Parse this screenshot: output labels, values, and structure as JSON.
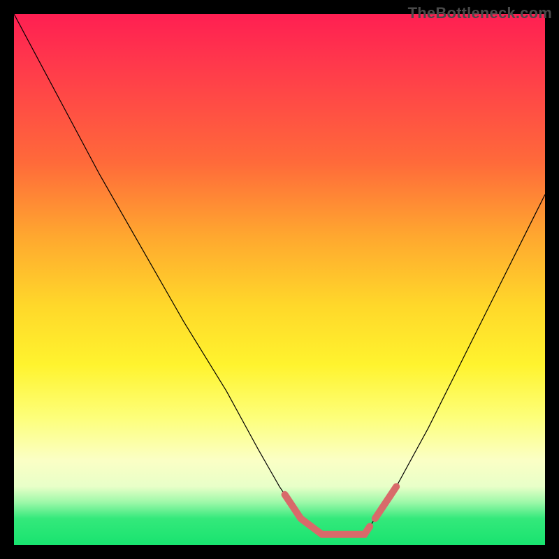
{
  "watermark": "TheBottleneck.com",
  "chart_data": {
    "type": "line",
    "title": "",
    "xlabel": "",
    "ylabel": "",
    "xlim": [
      0,
      100
    ],
    "ylim": [
      0,
      100
    ],
    "grid": false,
    "series": [
      {
        "name": "bottleneck-curve",
        "x": [
          0,
          8,
          16,
          24,
          32,
          40,
          46,
          50,
          54,
          58,
          62,
          66,
          68,
          72,
          78,
          84,
          90,
          96,
          100
        ],
        "values": [
          100,
          85,
          70,
          56,
          42,
          29,
          18,
          11,
          5,
          2,
          2,
          2,
          5,
          11,
          22,
          34,
          46,
          58,
          66
        ]
      }
    ],
    "highlight_segments": [
      {
        "name": "trough-left",
        "x_range": [
          51,
          67
        ],
        "style": "thick-pink"
      },
      {
        "name": "trough-right",
        "x_range": [
          68,
          72
        ],
        "style": "thick-pink"
      }
    ],
    "background_gradient": {
      "direction": "vertical",
      "stops": [
        {
          "pos": 0,
          "color": "#ff1f52"
        },
        {
          "pos": 28,
          "color": "#ff6a3a"
        },
        {
          "pos": 55,
          "color": "#ffd82a"
        },
        {
          "pos": 76,
          "color": "#fdff7a"
        },
        {
          "pos": 92,
          "color": "#9cf8a8"
        },
        {
          "pos": 100,
          "color": "#18e36f"
        }
      ]
    }
  }
}
